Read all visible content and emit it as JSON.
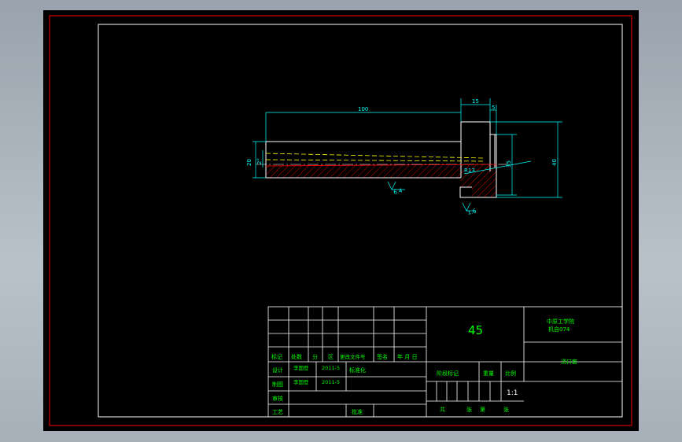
{
  "colors": {
    "background": "#000000",
    "frame_outer": "#ff0000",
    "frame_inner": "#ffffff",
    "part_outline": "#ffffff",
    "dimension": "#00ffff",
    "hatch": "#ff0000",
    "hidden_line": "#ffff00",
    "titleblock_text": "#00ff00"
  },
  "drawing": {
    "dimensions": {
      "length_total": "100",
      "head_length": "15",
      "head_step": "5",
      "dia_outer": "40",
      "dia_head_bore": "35",
      "dia_shank": "20",
      "dia_bore": "2°",
      "radius": "R13",
      "roughness_1": "6.4",
      "roughness_2": "1.6"
    }
  },
  "titleblock": {
    "material": "45",
    "school": "中原工学院",
    "class_no": "机自074",
    "part_name": "浇口套",
    "header_labels": [
      "标记",
      "处数",
      "分",
      "区",
      "更改文件号",
      "签名",
      "年 月 日"
    ],
    "row_design_label": "设计",
    "row_design_name": "李国登",
    "row_design_date": "2011-5",
    "row_design_std": "标准化",
    "row_draw_label": "制图",
    "row_draw_name": "李国登",
    "row_draw_date": "2011-5",
    "row_check_label": "审核",
    "row_process_label": "工艺",
    "row_approve_label": "批准",
    "stage_label": "阶段标记",
    "weight_label": "重量",
    "scale_label": "比例",
    "scale_value": "1:1",
    "sheet_total": "共",
    "sheet_unit": "张",
    "sheet_no": "第",
    "sheet_unit2": "张"
  }
}
